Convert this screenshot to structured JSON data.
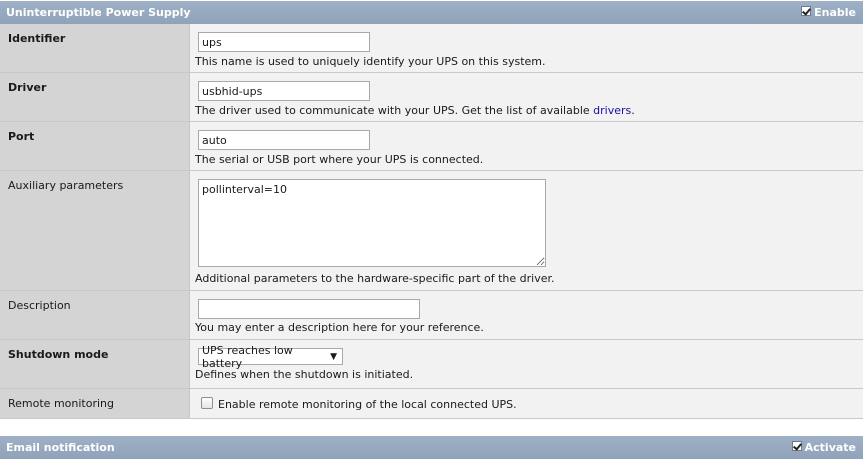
{
  "ups_section": {
    "title": "Uninterruptible Power Supply",
    "toggle_label": "Enable",
    "toggle_checked": true
  },
  "fields": {
    "identifier": {
      "label": "Identifier",
      "value": "ups",
      "hint": "This name is used to uniquely identify your UPS on this system."
    },
    "driver": {
      "label": "Driver",
      "value": "usbhid-ups",
      "hint_prefix": "The driver used to communicate with your UPS. Get the list of available ",
      "hint_link": "drivers",
      "hint_suffix": "."
    },
    "port": {
      "label": "Port",
      "value": "auto",
      "hint": "The serial or USB port where your UPS is connected."
    },
    "aux_params": {
      "label": "Auxiliary parameters",
      "value": "pollinterval=10",
      "hint": "Additional parameters to the hardware-specific part of the driver."
    },
    "description": {
      "label": "Description",
      "value": "",
      "hint": "You may enter a description here for your reference."
    },
    "shutdown_mode": {
      "label": "Shutdown mode",
      "selected": "UPS reaches low battery",
      "hint": "Defines when the shutdown is initiated."
    },
    "remote_monitoring": {
      "label": "Remote monitoring",
      "checkbox_label": "Enable remote monitoring of the local connected UPS.",
      "checked": false
    }
  },
  "email_section": {
    "title": "Email notification",
    "toggle_label": "Activate",
    "toggle_checked": true
  },
  "colors": {
    "header_bg": "#9fb1c6",
    "label_bg": "#d4d4d4",
    "row_bg": "#f2f2f2",
    "link": "#1a0dab"
  }
}
